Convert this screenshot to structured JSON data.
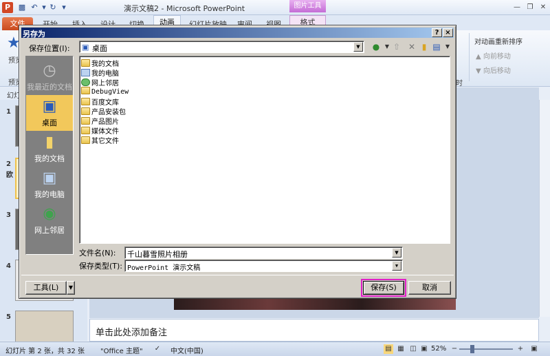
{
  "powerpoint": {
    "title": "演示文稿2 - Microsoft PowerPoint",
    "app_icon": "P",
    "picture_tools": "图片工具",
    "tabs": {
      "file": "文件",
      "start": "开始",
      "insert": "插入",
      "design": "设计",
      "transition": "切换",
      "animation": "动画",
      "slideshow": "幻灯片放映",
      "review": "审阅",
      "view": "视图",
      "format": "格式"
    },
    "ribbon": {
      "reorder": "对动画重新排序",
      "move_earlier": "向前移动",
      "move_later": "向后移动",
      "left_label_1": "预览",
      "left_label_2": "预览",
      "timing_fragment": "时"
    },
    "panel_head": "幻灯片",
    "slides": [
      {
        "num": "1"
      },
      {
        "num": "2",
        "text": "欧"
      },
      {
        "num": "3"
      },
      {
        "num": "4"
      },
      {
        "num": "5"
      }
    ],
    "notes_placeholder": "单击此处添加备注",
    "status": {
      "slide_info": "幻灯片 第 2 张，共 32 张",
      "theme": "\"Office 主题\"",
      "language": "中文(中国)",
      "zoom": "52%"
    }
  },
  "dialog": {
    "title": "另存为",
    "save_in_label": "保存位置(I):",
    "save_in_value": "桌面",
    "places": [
      {
        "label": "我最近的文档",
        "icon": "recent-icon"
      },
      {
        "label": "桌面",
        "icon": "desktop-icon"
      },
      {
        "label": "我的文档",
        "icon": "my-documents-icon"
      },
      {
        "label": "我的电脑",
        "icon": "my-computer-icon"
      },
      {
        "label": "网上邻居",
        "icon": "network-icon"
      }
    ],
    "files": [
      {
        "name": "我的文档",
        "icon": "my-documents-icon"
      },
      {
        "name": "我的电脑",
        "icon": "my-computer-icon"
      },
      {
        "name": "网上邻居",
        "icon": "network-icon"
      },
      {
        "name": "DebugView",
        "icon": "folder-icon"
      },
      {
        "name": "百度文库",
        "icon": "folder-icon"
      },
      {
        "name": "产品安装包",
        "icon": "folder-icon"
      },
      {
        "name": "产品图片",
        "icon": "folder-icon"
      },
      {
        "name": "媒体文件",
        "icon": "folder-icon"
      },
      {
        "name": "其它文件",
        "icon": "folder-icon"
      }
    ],
    "filename_label": "文件名(N):",
    "filename_value": "千山暮雪照片相册",
    "filetype_label": "保存类型(T):",
    "filetype_value": "PowerPoint 演示文稿",
    "tools_label": "工具(L)",
    "save_label": "保存(S)",
    "cancel_label": "取消",
    "help_btn": "?",
    "close_btn": "×"
  },
  "colors": {
    "dialog_title_start": "#0a246a",
    "dialog_title_end": "#a6caf0",
    "selected_place": "#f2c85b",
    "save_highlight": "#e020c8",
    "file_tab": "#d24726"
  }
}
